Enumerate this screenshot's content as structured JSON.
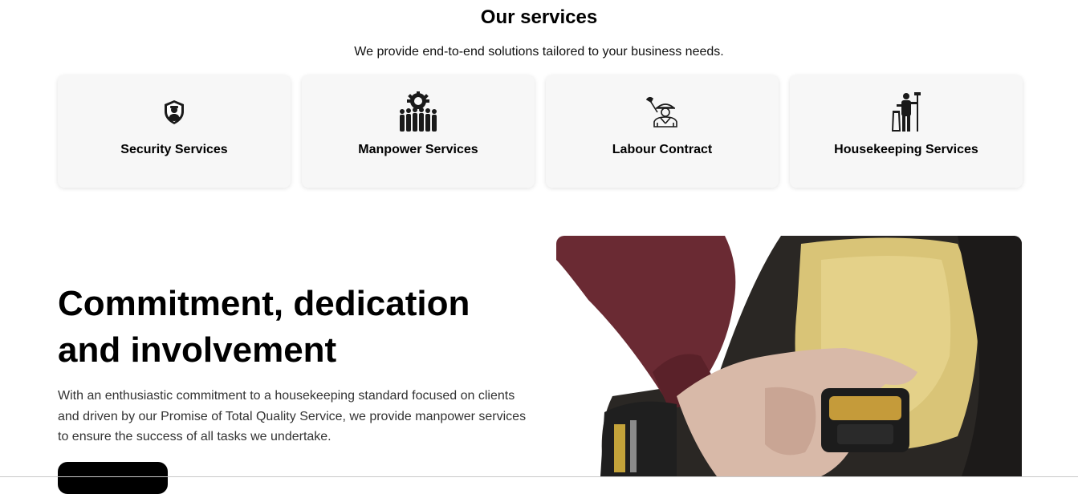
{
  "services": {
    "title": "Our services",
    "subtitle": "We provide end-to-end solutions tailored to your business needs.",
    "items": [
      {
        "label": "Security Services",
        "icon": "security-guard-shield-icon"
      },
      {
        "label": "Manpower Services",
        "icon": "workforce-gear-icon"
      },
      {
        "label": "Labour Contract",
        "icon": "construction-worker-icon"
      },
      {
        "label": "Housekeeping Services",
        "icon": "cleaner-mop-icon"
      }
    ]
  },
  "commitment": {
    "heading": "Commitment, dedication and involvement",
    "text": "With an enthusiastic commitment to a housekeeping standard focused on clients and driven by our Promise of Total Quality Service, we provide manpower services to ensure the success of all tasks we undertake.",
    "image": "worker-tool-belt-photo"
  },
  "colors": {
    "accent": "#000000",
    "card_bg": "#f7f7f7"
  }
}
